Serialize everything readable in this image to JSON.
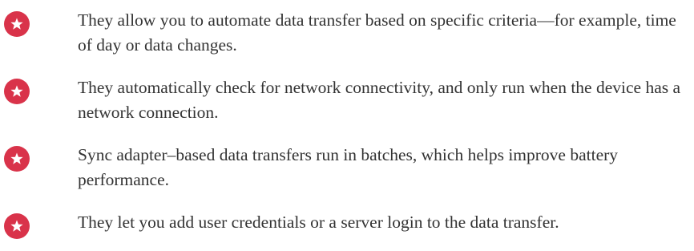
{
  "colors": {
    "badge": "#d9334a",
    "star": "#ffffff",
    "text": "#333333"
  },
  "icon": "star-badge-icon",
  "bullets": [
    {
      "text": "They allow you to automate data transfer based on specific criteria—for example, time of day or data changes."
    },
    {
      "text": "They automatically check for network connectivity, and only run when the device has a network connection."
    },
    {
      "text": "Sync adapter–based data transfers run in batches, which helps improve battery performance."
    },
    {
      "text": "They let you add user credentials or a server login to the data transfer."
    }
  ]
}
